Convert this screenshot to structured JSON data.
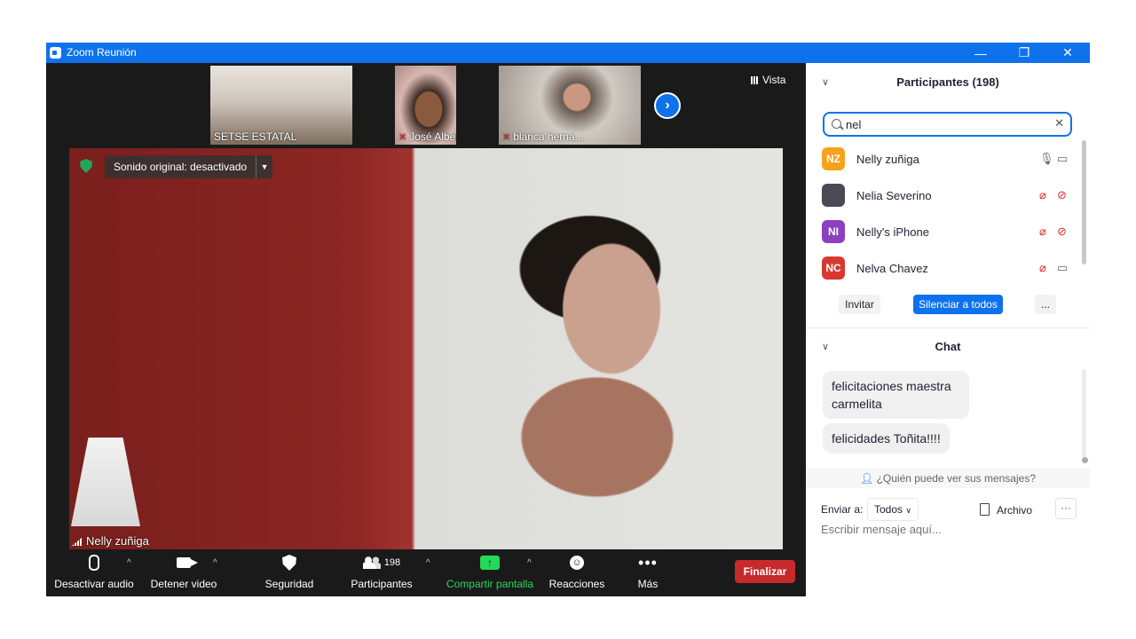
{
  "window": {
    "title": "Zoom Reunión",
    "minimize": "—",
    "restore": "❐",
    "close": "✕"
  },
  "gallery": {
    "tiles": [
      {
        "name": "SETSE ESTATAL",
        "muted": false
      },
      {
        "name": "José Alberto ...",
        "muted": true
      },
      {
        "name": "blanca herna...",
        "muted": true
      }
    ],
    "next_icon": "chevron-right-icon",
    "vista_label": "Vista"
  },
  "speaker": {
    "original_sound": "Sonido original: desactivado",
    "name": "Nelly zuñiga"
  },
  "toolbar": {
    "mute": "Desactivar audio",
    "video": "Detener video",
    "security": "Seguridad",
    "participants": "Participantes",
    "participants_count": "198",
    "share": "Compartir pantalla",
    "reactions": "Reacciones",
    "more": "Más",
    "end": "Finalizar"
  },
  "participants_panel": {
    "title": "Participantes (198)",
    "search_value": "nel",
    "list": [
      {
        "initials": "NZ",
        "name": "Nelly zuñiga",
        "color": "#f7a21b",
        "mic_muted": false,
        "cam_off": false
      },
      {
        "initials": "",
        "name": "Nelia Severino",
        "color": "#4a4a55",
        "mic_muted": true,
        "cam_off": true
      },
      {
        "initials": "NI",
        "name": "Nelly's iPhone",
        "color": "#8c3fbf",
        "mic_muted": true,
        "cam_off": true
      },
      {
        "initials": "NC",
        "name": "Nelva Chavez",
        "color": "#d8382f",
        "mic_muted": true,
        "cam_off": false
      }
    ],
    "invite": "Invitar",
    "mute_all": "Silenciar a todos",
    "more": "..."
  },
  "chat": {
    "title": "Chat",
    "messages": [
      "felicitaciones maestra carmelita",
      "felicidades Toñita!!!!"
    ],
    "who_sees": "¿Quién puede ver sus mensajes?",
    "send_to_label": "Enviar a:",
    "recipient": "Todos",
    "file_label": "Archivo",
    "input_placeholder": "Escribir mensaje aquí..."
  },
  "colors": {
    "accent": "#0e72ed",
    "danger": "#c72a2a",
    "share_green": "#23d959",
    "muted_red": "#e02828"
  }
}
